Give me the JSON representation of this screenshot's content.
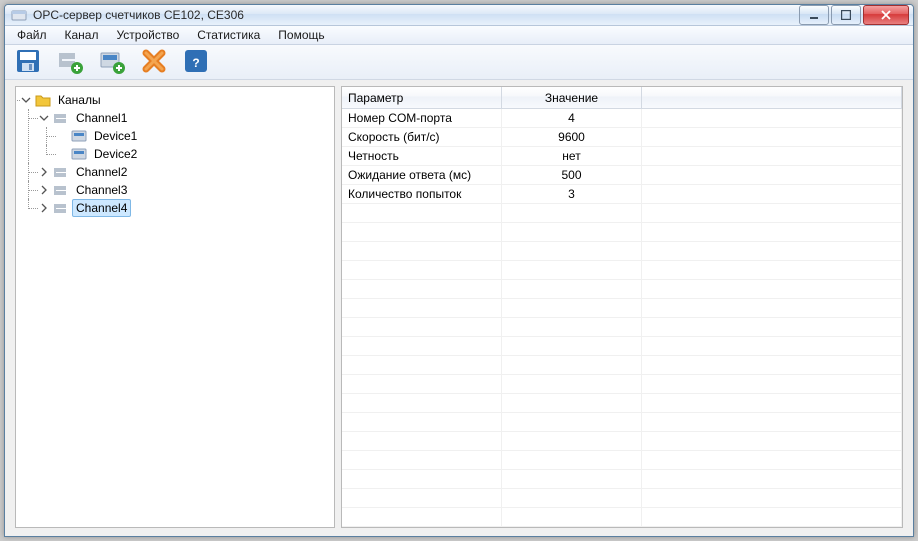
{
  "window": {
    "title": "OPC-сервер счетчиков CE102, CE306"
  },
  "menu": {
    "file": "Файл",
    "channel": "Канал",
    "device": "Устройство",
    "stats": "Статистика",
    "help": "Помощь"
  },
  "tree": {
    "root": "Каналы",
    "channels": [
      {
        "name": "Channel1",
        "expanded": true,
        "selected": false,
        "devices": [
          "Device1",
          "Device2"
        ]
      },
      {
        "name": "Channel2",
        "expanded": false,
        "selected": false,
        "devices": []
      },
      {
        "name": "Channel3",
        "expanded": false,
        "selected": false,
        "devices": []
      },
      {
        "name": "Channel4",
        "expanded": false,
        "selected": true,
        "devices": []
      }
    ]
  },
  "grid": {
    "headers": {
      "param": "Параметр",
      "value": "Значение"
    },
    "rows": [
      {
        "param": "Номер COM-порта",
        "value": "4"
      },
      {
        "param": "Скорость (бит/с)",
        "value": "9600"
      },
      {
        "param": "Четность",
        "value": "нет"
      },
      {
        "param": "Ожидание ответа (мс)",
        "value": "500"
      },
      {
        "param": "Количество попыток",
        "value": "3"
      }
    ]
  }
}
